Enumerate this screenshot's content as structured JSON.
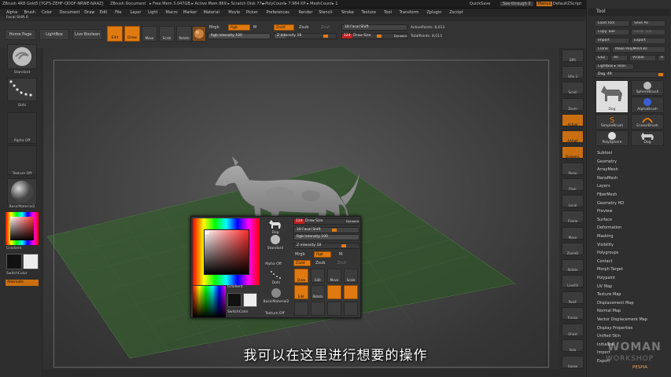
{
  "titlebar": {
    "title": "ZBrush 4R8 Gold5 [YGFS-ZEHF-QDOF-NRWE-NAAZ]",
    "doc": "ZBrush Document",
    "mem": "▸ Free Mem 3.047GB ▸ Active Mem 869 ▸ Scratch Disk 77 ▸",
    "poly": "▸ PolyCount▸ 7.984 KP ▸ MeshCount▸ 1",
    "quicksave": "QuickSave",
    "seethrough": "See-through 0",
    "menus": "Menus",
    "script": "DefaultZScript"
  },
  "menubar": [
    "Alpha",
    "Brush",
    "Color",
    "Document",
    "Draw",
    "Edit",
    "File",
    "Layer",
    "Light",
    "Macro",
    "Marker",
    "Material",
    "Movie",
    "Picker",
    "Preferences",
    "Render",
    "Stencil",
    "Stroke",
    "Texture",
    "Tool",
    "Transform",
    "Zplugin",
    "Zscript"
  ],
  "focal_top": "Focal Shift 0",
  "shelf": {
    "home": "Home Page",
    "lightbox": "LightBox",
    "boolean": "Live Boolean",
    "edit": "Edit",
    "draw": "Draw",
    "move": "Move",
    "scale": "Scale",
    "rotate": "Rotate",
    "mrgb": "Mrgb",
    "rgb": "Rgb",
    "m": "M",
    "zadd": "Zadd",
    "zsub": "Zsub",
    "zcut": "Zcut",
    "rgb_intensity": "Rgb Intensity 100",
    "z_intensity": "Z Intensity 18",
    "focal_shift": "18 Focal Shift",
    "draw_size_num": "124",
    "draw_size": "Draw Size",
    "dynamic": "Dynamic",
    "active_points": "ActivePoints: 8,013",
    "total_points": "TotalPoints: 8,013"
  },
  "leftbar": {
    "brush": "Standard",
    "stroke": "Dots",
    "alpha": "Alpha Off",
    "texture": "Texture Off",
    "material": "BasicMaterial2",
    "gradient": "Gradient",
    "switch": "SwitchColor",
    "alternate": "Alternate"
  },
  "rightstrip": [
    "BPR",
    "SPix 3",
    "Scroll",
    "Zoom",
    "Actual",
    "AAHalf",
    "Dynamic",
    "Persp",
    "Floor",
    "Local",
    "Frame",
    "Move",
    "ZoomD",
    "Rotate",
    "LineFill",
    "PolyF",
    "Transp",
    "Ghost",
    "Solo",
    "Xpose"
  ],
  "toolpanel": {
    "header": "Tool",
    "load": "Load Tool",
    "save": "Save As",
    "copy": "Copy Tool",
    "paste": "Paste Tool",
    "import": "Import",
    "export": "Export",
    "clone": "Clone",
    "polymesh": "Make PolyMesh3D",
    "goz": "GoZ",
    "all": "All",
    "visible": "Visible",
    "r": "R",
    "lightbox": "Lightbox ▸ Tools",
    "dog": "Dog. 49",
    "thumbs": [
      "Dog",
      "SphereBrush",
      "AlphaBrush",
      "SimpleBrush",
      "EraserBrush",
      "PolySphere",
      "Dog"
    ],
    "items": [
      "Subtool",
      "Geometry",
      "ArrayMesh",
      "NanoMesh",
      "Layers",
      "FiberMesh",
      "Geometry HD",
      "Preview",
      "Surface",
      "Deformation",
      "Masking",
      "Visibility",
      "Polygroups",
      "Contact",
      "Morph Target",
      "Polypaint",
      "UV Map",
      "Texture Map",
      "Displacement Map",
      "Normal Map",
      "Vector Displacement Map",
      "Display Properties",
      "Unified Skin",
      "Initialize",
      "Import",
      "Export"
    ]
  },
  "popup": {
    "draw_size_num": "124",
    "draw_size": "Draw Size",
    "dynamic": "Dynamic",
    "focal": "18 Focal Shift",
    "rgb_int": "Rgb Intensity 100",
    "z_int": "Z Intensity 18",
    "mrgb": "Mrgb",
    "rgb": "Rgb",
    "m": "M",
    "zadd": "Zadd",
    "zsub": "Zsub",
    "zcut": "Zcut",
    "dog": "Dog",
    "standard": "Standard",
    "alpha": "Alpha Off",
    "dots": "Dots",
    "gradient": "Gradient",
    "material": "BasicMaterial2",
    "switch": "SwitchColor",
    "texture": "Texture Off",
    "tools": [
      "Draw",
      "Edit",
      "Move",
      "Scale",
      "Rotate"
    ]
  },
  "subtitle": "我可以在这里进行想要的操作",
  "watermark": {
    "brand": "WOMAN",
    "sub": "WORKSHOP",
    "tag": "PESPIA"
  },
  "colors": {
    "accent": "#e07a10",
    "grid": "#3e5a38"
  }
}
